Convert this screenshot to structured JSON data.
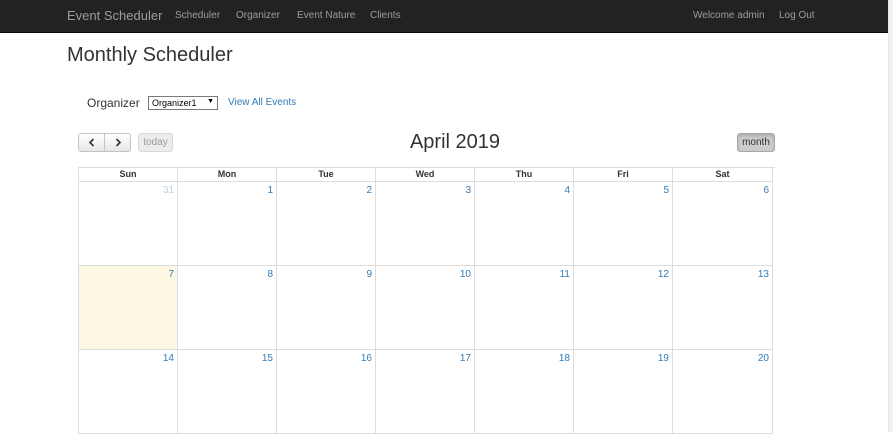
{
  "navbar": {
    "brand": "Event Scheduler",
    "links": [
      "Scheduler",
      "Organizer",
      "Event Nature",
      "Clients"
    ],
    "welcome": "Welcome admin",
    "logout": "Log Out"
  },
  "page": {
    "title": "Monthly Scheduler"
  },
  "filter": {
    "organizer_label": "Organizer",
    "organizer_selected": "Organizer1",
    "view_all": "View All Events"
  },
  "toolbar": {
    "prev_icon": "chevron-left-icon",
    "next_icon": "chevron-right-icon",
    "today_label": "today",
    "title": "April 2019",
    "month_label": "month"
  },
  "calendar": {
    "weekdays": [
      "Sun",
      "Mon",
      "Tue",
      "Wed",
      "Thu",
      "Fri",
      "Sat"
    ],
    "weeks": [
      [
        "31",
        "1",
        "2",
        "3",
        "4",
        "5",
        "6"
      ],
      [
        "7",
        "8",
        "9",
        "10",
        "11",
        "12",
        "13"
      ],
      [
        "14",
        "15",
        "16",
        "17",
        "18",
        "19",
        "20"
      ]
    ],
    "today": "7",
    "other_month": [
      "31"
    ]
  },
  "colors": {
    "navbar_bg": "#222222",
    "nav_text": "#9d9d9d",
    "link": "#337ab7",
    "today_highlight": "#fcf8e3",
    "grid_border": "#dddddd"
  }
}
